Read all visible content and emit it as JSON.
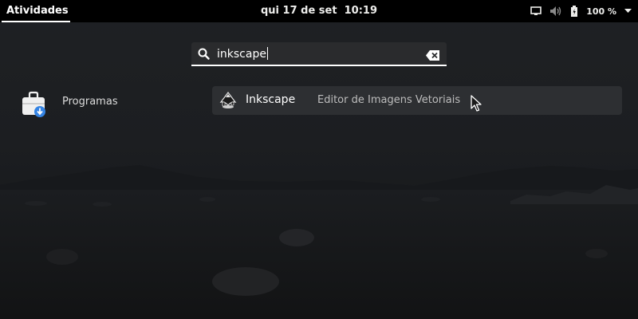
{
  "topbar": {
    "activities_label": "Atividades",
    "clock": "qui 17 de set  10:19",
    "battery_percent": "100 %",
    "icons": [
      "display-icon",
      "volume-icon",
      "battery-icon",
      "menu-arrow-icon"
    ]
  },
  "search": {
    "value": "inkscape",
    "icon": "search-icon",
    "clear_icon": "clear-icon"
  },
  "provider": {
    "label": "Programas",
    "icon": "software-bag-icon"
  },
  "results": [
    {
      "name": "Inkscape",
      "description": "Editor de Imagens Vetoriais",
      "icon": "inkscape-icon"
    }
  ],
  "colors": {
    "topbar_bg": "#000000",
    "accent_underline": "#ffffff",
    "result_bg": "#2d2f32",
    "search_bg": "#2a2b2d"
  }
}
